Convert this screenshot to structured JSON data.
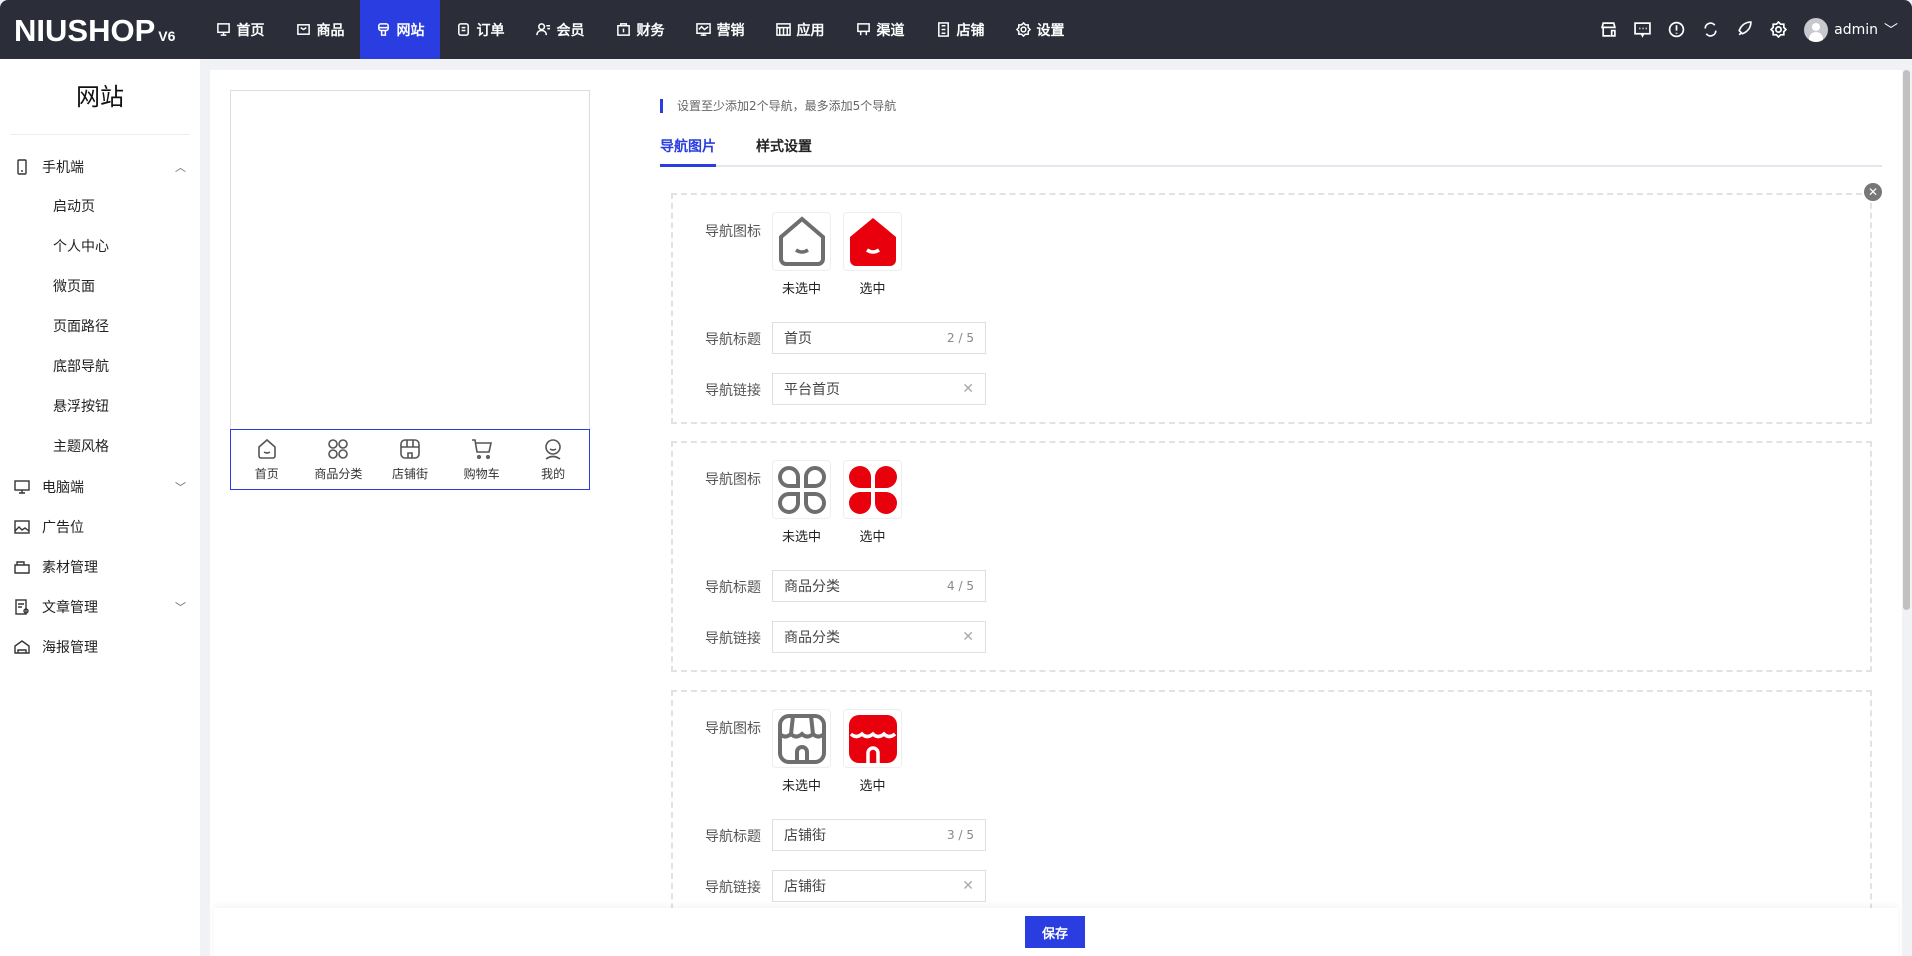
{
  "app": {
    "logo": "NIUSHOP",
    "version": "V6",
    "user": "admin"
  },
  "nav": [
    {
      "label": "首页",
      "icon": "monitor-icon"
    },
    {
      "label": "商品",
      "icon": "box-icon"
    },
    {
      "label": "网站",
      "icon": "website-icon",
      "active": true
    },
    {
      "label": "订单",
      "icon": "order-icon"
    },
    {
      "label": "会员",
      "icon": "member-icon"
    },
    {
      "label": "财务",
      "icon": "finance-icon"
    },
    {
      "label": "营销",
      "icon": "marketing-icon"
    },
    {
      "label": "应用",
      "icon": "apps-icon"
    },
    {
      "label": "渠道",
      "icon": "channel-icon"
    },
    {
      "label": "店铺",
      "icon": "store-icon"
    },
    {
      "label": "设置",
      "icon": "gear-icon"
    }
  ],
  "sidebar": {
    "title": "网站",
    "mobile": {
      "label": "手机端",
      "items": [
        "启动页",
        "个人中心",
        "微页面",
        "页面路径",
        "底部导航",
        "悬浮按钮",
        "主题风格"
      ]
    },
    "pc": "电脑端",
    "ad": "广告位",
    "material": "素材管理",
    "article": "文章管理",
    "poster": "海报管理"
  },
  "preview": {
    "items": [
      "首页",
      "商品分类",
      "店铺街",
      "购物车",
      "我的"
    ]
  },
  "notice": "设置至少添加2个导航，最多添加5个导航",
  "tabs": [
    "导航图片",
    "样式设置"
  ],
  "form": {
    "icon_label": "导航图标",
    "title_label": "导航标题",
    "link_label": "导航链接",
    "unselected": "未选中",
    "selected": "选中",
    "items": [
      {
        "title": "首页",
        "count": "2 / 5",
        "link": "平台首页"
      },
      {
        "title": "商品分类",
        "count": "4 / 5",
        "link": "商品分类"
      },
      {
        "title": "店铺街",
        "count": "3 / 5",
        "link": "店铺街"
      }
    ]
  },
  "save_label": "保存",
  "colors": {
    "accent": "#2a3de0",
    "selected": "#e8000d",
    "topbar": "#2b2e39"
  }
}
